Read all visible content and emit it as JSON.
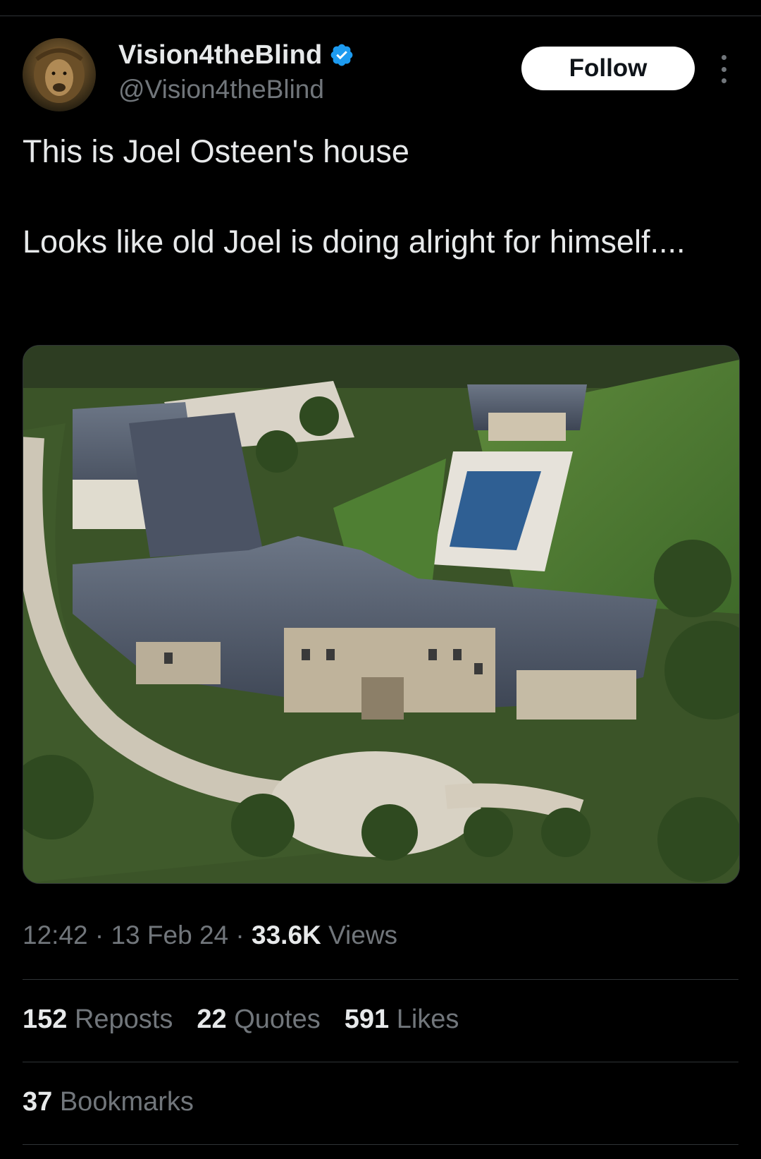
{
  "author": {
    "display_name": "Vision4theBlind",
    "handle": "@Vision4theBlind",
    "verified": true,
    "avatar_icon": "lion-avatar-icon"
  },
  "actions": {
    "follow_label": "Follow",
    "more_icon": "more-options-icon"
  },
  "tweet": {
    "line1": "This is Joel Osteen's house",
    "line2": "Looks like old Joel is doing alright for himself...."
  },
  "meta": {
    "time": "12:42",
    "sep1": " · ",
    "date": "13 Feb 24",
    "sep2": " · ",
    "views_count": "33.6K",
    "views_label": " Views"
  },
  "stats": {
    "reposts": {
      "count": "152",
      "label": " Reposts"
    },
    "quotes": {
      "count": "22",
      "label": " Quotes"
    },
    "likes": {
      "count": "591",
      "label": " Likes"
    },
    "bookmarks": {
      "count": "37",
      "label": " Bookmarks"
    }
  },
  "colors": {
    "background": "#000000",
    "text_primary": "#e7e9ea",
    "text_secondary": "#71767b",
    "verified_blue": "#1d9bf0",
    "divider": "#2f3336"
  }
}
